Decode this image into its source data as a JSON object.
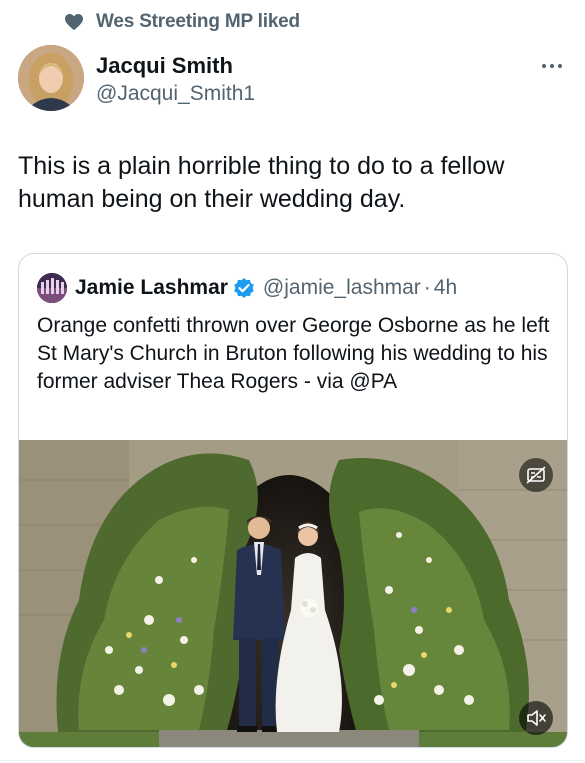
{
  "social_context": {
    "text": "Wes Streeting MP liked",
    "icon": "heart-icon"
  },
  "author": {
    "name": "Jacqui Smith",
    "handle": "@Jacqui_Smith1"
  },
  "tweet": {
    "text": "This is a plain horrible thing to do to a fellow human being on their wedding day."
  },
  "quote": {
    "name": "Jamie Lashmar",
    "verified": true,
    "handle": "@jamie_lashmar",
    "separator": "·",
    "time": "4h",
    "text": "Orange confetti thrown over George Osborne as he left St Mary's Church in Bruton following his wedding to his former adviser Thea Rogers - via @PA"
  },
  "media": {
    "type": "video",
    "icons": [
      "captions-off-icon",
      "mute-icon"
    ]
  },
  "colors": {
    "secondary_text": "#536471",
    "verified_blue": "#1d9bf0",
    "border": "#cfd9de"
  }
}
